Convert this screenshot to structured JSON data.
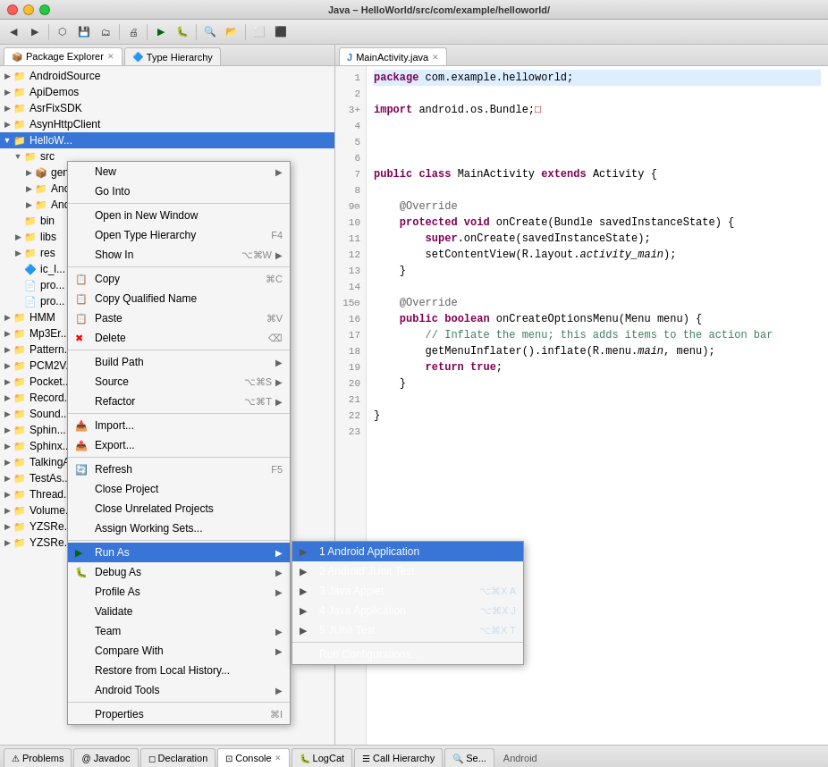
{
  "titleBar": {
    "title": "Java – HelloWorld/src/com/example/helloworld/",
    "closeBtn": "●",
    "minBtn": "●",
    "maxBtn": "●"
  },
  "toolbar": {
    "items": [
      "⬅",
      "⬇",
      "◀",
      "▶",
      "⬡",
      "⟳",
      "⚙",
      "|",
      "▶",
      "⚙",
      "|",
      "⬛",
      "⬜",
      "|",
      "❐",
      "⊕",
      "|",
      "☰"
    ]
  },
  "leftPanel": {
    "tabs": [
      {
        "label": "Package Explorer",
        "icon": "📦",
        "active": true
      },
      {
        "label": "Type Hierarchy",
        "icon": "🔷",
        "active": false
      }
    ],
    "tree": [
      {
        "indent": 0,
        "arrow": "▶",
        "icon": "📁",
        "iconClass": "icon-folder",
        "label": "AndroidSource",
        "selected": false
      },
      {
        "indent": 0,
        "arrow": "▶",
        "icon": "📁",
        "iconClass": "icon-folder",
        "label": "ApiDemos",
        "selected": false
      },
      {
        "indent": 0,
        "arrow": "▶",
        "icon": "📁",
        "iconClass": "icon-folder",
        "label": "AsrFixSDK",
        "selected": false
      },
      {
        "indent": 0,
        "arrow": "▶",
        "icon": "📁",
        "iconClass": "icon-folder",
        "label": "AsynHttpClient",
        "selected": false
      },
      {
        "indent": 0,
        "arrow": "▼",
        "icon": "📁",
        "iconClass": "icon-project selected-project",
        "label": "HelloW...",
        "selected": true
      },
      {
        "indent": 1,
        "arrow": "▼",
        "icon": "📁",
        "iconClass": "icon-folder",
        "label": "src",
        "selected": false
      },
      {
        "indent": 2,
        "arrow": "▶",
        "icon": "📦",
        "iconClass": "icon-package",
        "label": "gen",
        "selected": false
      },
      {
        "indent": 2,
        "arrow": "▶",
        "icon": "📦",
        "iconClass": "icon-package",
        "label": "And...",
        "selected": false
      },
      {
        "indent": 2,
        "arrow": "▶",
        "icon": "📦",
        "iconClass": "icon-package",
        "label": "And...",
        "selected": false
      },
      {
        "indent": 1,
        "arrow": "",
        "icon": "📁",
        "iconClass": "icon-folder",
        "label": "bin",
        "selected": false
      },
      {
        "indent": 1,
        "arrow": "▶",
        "icon": "📁",
        "iconClass": "icon-folder",
        "label": "libs",
        "selected": false
      },
      {
        "indent": 1,
        "arrow": "▶",
        "icon": "📁",
        "iconClass": "icon-folder",
        "label": "res",
        "selected": false
      },
      {
        "indent": 1,
        "arrow": "",
        "icon": "🔷",
        "iconClass": "icon-java",
        "label": "ic_l...",
        "selected": false
      },
      {
        "indent": 1,
        "arrow": "",
        "icon": "📄",
        "iconClass": "icon-file",
        "label": "pro...",
        "selected": false
      },
      {
        "indent": 1,
        "arrow": "",
        "icon": "📄",
        "iconClass": "icon-file",
        "label": "pro...",
        "selected": false
      },
      {
        "indent": 0,
        "arrow": "▶",
        "icon": "📁",
        "iconClass": "icon-folder",
        "label": "HMM",
        "selected": false
      },
      {
        "indent": 0,
        "arrow": "▶",
        "icon": "📁",
        "iconClass": "icon-folder",
        "label": "Mp3Er...",
        "selected": false
      },
      {
        "indent": 0,
        "arrow": "▶",
        "icon": "📁",
        "iconClass": "icon-folder",
        "label": "Pattern...",
        "selected": false
      },
      {
        "indent": 0,
        "arrow": "▶",
        "icon": "📁",
        "iconClass": "icon-folder",
        "label": "PCM2V...",
        "selected": false
      },
      {
        "indent": 0,
        "arrow": "▶",
        "icon": "📁",
        "iconClass": "icon-folder",
        "label": "Pocket...",
        "selected": false
      },
      {
        "indent": 0,
        "arrow": "▶",
        "icon": "📁",
        "iconClass": "icon-folder",
        "label": "Record...",
        "selected": false
      },
      {
        "indent": 0,
        "arrow": "▶",
        "icon": "📁",
        "iconClass": "icon-folder",
        "label": "Sound...",
        "selected": false
      },
      {
        "indent": 0,
        "arrow": "▶",
        "icon": "📁",
        "iconClass": "icon-folder",
        "label": "Sphin...",
        "selected": false
      },
      {
        "indent": 0,
        "arrow": "▶",
        "icon": "📁",
        "iconClass": "icon-folder",
        "label": "Sphinx...",
        "selected": false
      },
      {
        "indent": 0,
        "arrow": "▶",
        "icon": "📁",
        "iconClass": "icon-folder",
        "label": "TalkingA...",
        "selected": false
      },
      {
        "indent": 0,
        "arrow": "▶",
        "icon": "📁",
        "iconClass": "icon-folder",
        "label": "TestAs...",
        "selected": false
      },
      {
        "indent": 0,
        "arrow": "▶",
        "icon": "📁",
        "iconClass": "icon-folder",
        "label": "Thread...",
        "selected": false
      },
      {
        "indent": 0,
        "arrow": "▶",
        "icon": "📁",
        "iconClass": "icon-folder",
        "label": "Volume...",
        "selected": false
      },
      {
        "indent": 0,
        "arrow": "▶",
        "icon": "📁",
        "iconClass": "icon-folder",
        "label": "YZSRe...",
        "selected": false
      },
      {
        "indent": 0,
        "arrow": "▶",
        "icon": "📁",
        "iconClass": "icon-folder",
        "label": "YZSRe...",
        "selected": false
      }
    ]
  },
  "rightPanel": {
    "tabs": [
      {
        "label": "MainActivity.java",
        "icon": "J",
        "active": true,
        "hasClose": true
      }
    ],
    "code": {
      "lines": [
        {
          "num": 1,
          "text": "package com.example.helloworld;"
        },
        {
          "num": 2,
          "text": ""
        },
        {
          "num": 3,
          "text": "import android.os.Bundle;"
        },
        {
          "num": 4,
          "text": ""
        },
        {
          "num": 5,
          "text": ""
        },
        {
          "num": 6,
          "text": ""
        },
        {
          "num": 7,
          "text": "public class MainActivity extends Activity {"
        },
        {
          "num": 8,
          "text": ""
        },
        {
          "num": 9,
          "text": "    @Override"
        },
        {
          "num": 10,
          "text": "    protected void onCreate(Bundle savedInstanceState) {"
        },
        {
          "num": 11,
          "text": "        super.onCreate(savedInstanceState);"
        },
        {
          "num": 12,
          "text": "        setContentView(R.layout.activity_main);"
        },
        {
          "num": 13,
          "text": "    }"
        },
        {
          "num": 14,
          "text": ""
        },
        {
          "num": 15,
          "text": "    @Override"
        },
        {
          "num": 16,
          "text": "    public boolean onCreateOptionsMenu(Menu menu) {"
        },
        {
          "num": 17,
          "text": "        // Inflate the menu; this adds items to the action bar"
        },
        {
          "num": 18,
          "text": "        getMenuInflater().inflate(R.menu.main, menu);"
        },
        {
          "num": 19,
          "text": "        return true;"
        },
        {
          "num": 20,
          "text": "    }"
        },
        {
          "num": 21,
          "text": ""
        },
        {
          "num": 22,
          "text": "}"
        },
        {
          "num": 23,
          "text": ""
        }
      ]
    }
  },
  "contextMenu": {
    "items": [
      {
        "id": "new",
        "icon": "",
        "label": "New",
        "shortcut": "",
        "hasArrow": true,
        "type": "item"
      },
      {
        "id": "go-into",
        "icon": "",
        "label": "Go Into",
        "shortcut": "",
        "hasArrow": false,
        "type": "item"
      },
      {
        "type": "separator"
      },
      {
        "id": "open-new-window",
        "icon": "",
        "label": "Open in New Window",
        "shortcut": "",
        "hasArrow": false,
        "type": "item"
      },
      {
        "id": "open-type-hierarchy",
        "icon": "",
        "label": "Open Type Hierarchy",
        "shortcut": "F4",
        "hasArrow": false,
        "type": "item"
      },
      {
        "id": "show-in",
        "icon": "",
        "label": "Show In",
        "shortcut": "⌥⌘W",
        "hasArrow": true,
        "type": "item"
      },
      {
        "type": "separator"
      },
      {
        "id": "copy",
        "icon": "📋",
        "label": "Copy",
        "shortcut": "⌘C",
        "hasArrow": false,
        "type": "item"
      },
      {
        "id": "copy-qualified",
        "icon": "📋",
        "label": "Copy Qualified Name",
        "shortcut": "",
        "hasArrow": false,
        "type": "item"
      },
      {
        "id": "paste",
        "icon": "📋",
        "label": "Paste",
        "shortcut": "⌘V",
        "hasArrow": false,
        "type": "item"
      },
      {
        "id": "delete",
        "icon": "✖",
        "label": "Delete",
        "shortcut": "⌫",
        "hasArrow": false,
        "type": "item"
      },
      {
        "type": "separator"
      },
      {
        "id": "build-path",
        "icon": "",
        "label": "Build Path",
        "shortcut": "",
        "hasArrow": true,
        "type": "item"
      },
      {
        "id": "source",
        "icon": "",
        "label": "Source",
        "shortcut": "⌥⌘S",
        "hasArrow": true,
        "type": "item"
      },
      {
        "id": "refactor",
        "icon": "",
        "label": "Refactor",
        "shortcut": "⌥⌘T",
        "hasArrow": true,
        "type": "item"
      },
      {
        "type": "separator"
      },
      {
        "id": "import",
        "icon": "📥",
        "label": "Import...",
        "shortcut": "",
        "hasArrow": false,
        "type": "item"
      },
      {
        "id": "export",
        "icon": "📤",
        "label": "Export...",
        "shortcut": "",
        "hasArrow": false,
        "type": "item"
      },
      {
        "type": "separator"
      },
      {
        "id": "refresh",
        "icon": "🔄",
        "label": "Refresh",
        "shortcut": "F5",
        "hasArrow": false,
        "type": "item"
      },
      {
        "id": "close-project",
        "icon": "",
        "label": "Close Project",
        "shortcut": "",
        "hasArrow": false,
        "type": "item"
      },
      {
        "id": "close-unrelated",
        "icon": "",
        "label": "Close Unrelated Projects",
        "shortcut": "",
        "hasArrow": false,
        "type": "item"
      },
      {
        "id": "assign-working-sets",
        "icon": "",
        "label": "Assign Working Sets...",
        "shortcut": "",
        "hasArrow": false,
        "type": "item"
      },
      {
        "type": "separator"
      },
      {
        "id": "run-as",
        "icon": "",
        "label": "Run As",
        "shortcut": "",
        "hasArrow": true,
        "type": "item",
        "selected": true
      },
      {
        "id": "debug-as",
        "icon": "",
        "label": "Debug As",
        "shortcut": "",
        "hasArrow": true,
        "type": "item"
      },
      {
        "id": "profile-as",
        "icon": "",
        "label": "Profile As",
        "shortcut": "",
        "hasArrow": true,
        "type": "item"
      },
      {
        "id": "validate",
        "icon": "",
        "label": "Validate",
        "shortcut": "",
        "hasArrow": false,
        "type": "item"
      },
      {
        "id": "team",
        "icon": "",
        "label": "Team",
        "shortcut": "",
        "hasArrow": true,
        "type": "item"
      },
      {
        "id": "compare-with",
        "icon": "",
        "label": "Compare With",
        "shortcut": "",
        "hasArrow": true,
        "type": "item"
      },
      {
        "id": "restore-local",
        "icon": "",
        "label": "Restore from Local History...",
        "shortcut": "",
        "hasArrow": false,
        "type": "item"
      },
      {
        "id": "android-tools",
        "icon": "",
        "label": "Android Tools",
        "shortcut": "",
        "hasArrow": true,
        "type": "item"
      },
      {
        "type": "separator"
      },
      {
        "id": "properties",
        "icon": "",
        "label": "Properties",
        "shortcut": "⌘I",
        "hasArrow": false,
        "type": "item"
      }
    ],
    "submenu": {
      "parentId": "run-as",
      "items": [
        {
          "id": "android-app",
          "icon": "▶",
          "iconClass": "run-btn",
          "label": "1 Android Application",
          "shortcut": "",
          "selected": true
        },
        {
          "id": "android-junit",
          "icon": "▶",
          "iconClass": "run-btn",
          "label": "2 Android JUnit Test",
          "shortcut": ""
        },
        {
          "id": "java-applet",
          "icon": "▶",
          "iconClass": "run-btn",
          "label": "3 Java Applet",
          "shortcut": "⌥⌘X A"
        },
        {
          "id": "java-app",
          "icon": "▶",
          "iconClass": "run-btn",
          "label": "4 Java Application",
          "shortcut": "⌥⌘X J"
        },
        {
          "id": "junit-test",
          "icon": "▶",
          "iconClass": "run-btn",
          "label": "5 JUnit Test",
          "shortcut": "⌥⌘X T"
        },
        {
          "type": "separator"
        },
        {
          "id": "run-configs",
          "icon": "",
          "label": "Run Configurations...",
          "shortcut": ""
        }
      ]
    }
  },
  "bottomBar": {
    "tabs": [
      {
        "label": "Problems",
        "icon": "⚠",
        "active": false
      },
      {
        "label": "Javadoc",
        "icon": "@",
        "active": false
      },
      {
        "label": "Declaration",
        "icon": "◻",
        "active": false
      },
      {
        "label": "Console",
        "icon": "⊡",
        "active": true
      },
      {
        "label": "LogCat",
        "icon": "🐛",
        "active": false
      },
      {
        "label": "Call Hierarchy",
        "icon": "☰",
        "active": false
      },
      {
        "label": "Se...",
        "icon": "🔍",
        "active": false
      }
    ],
    "label": "Android"
  }
}
